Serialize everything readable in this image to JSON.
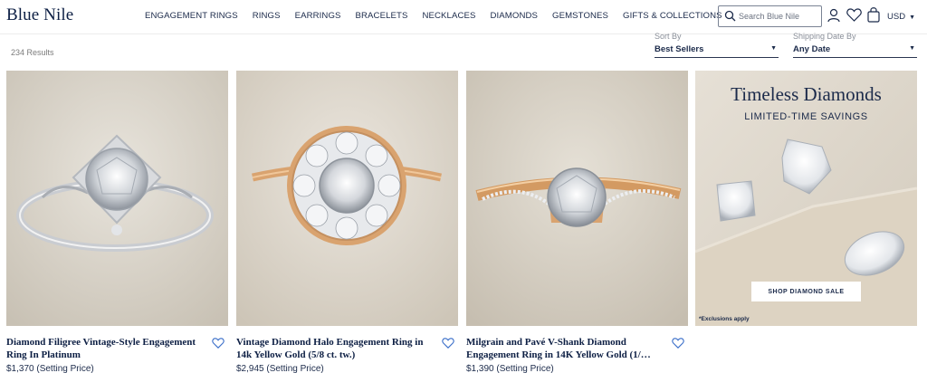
{
  "header": {
    "logo": "Blue Nile",
    "nav": [
      "ENGAGEMENT RINGS",
      "RINGS",
      "EARRINGS",
      "BRACELETS",
      "NECKLACES",
      "DIAMONDS",
      "GEMSTONES",
      "GIFTS & COLLECTIONS"
    ],
    "search_placeholder": "Search Blue Nile",
    "currency": "USD",
    "icons": [
      "search-icon",
      "account-icon",
      "wishlist-icon",
      "bag-icon",
      "chevron-down-icon"
    ]
  },
  "toolbar": {
    "results": "234 Results",
    "sort": {
      "label": "Sort By",
      "value": "Best Sellers"
    },
    "shipping": {
      "label": "Shipping Date By",
      "value": "Any Date"
    }
  },
  "products": [
    {
      "title": "Diamond Filigree Vintage-Style Engagement Ring In Platinum",
      "price": "$1,370 (Setting Price)",
      "metal": "#d8d8d8"
    },
    {
      "title": "Vintage Diamond Halo Engagement Ring in 14k Yellow Gold (5/8 ct. tw.)",
      "price": "$2,945 (Setting Price)",
      "metal": "#d9a36f"
    },
    {
      "title": "Milgrain and Pavé V-Shank Diamond Engagement Ring in 14K Yellow Gold (1/…",
      "price": "$1,390 (Setting Price)",
      "metal": "#d39a62"
    }
  ],
  "promo": {
    "heading": "Timeless Diamonds",
    "subheading": "LIMITED-TIME SAVINGS",
    "button": "SHOP DIAMOND SALE",
    "note": "*Exclusions apply"
  },
  "colors": {
    "brand": "#0d1f44",
    "heart": "#3b6fc9",
    "background_card": "#d8d2c7"
  }
}
